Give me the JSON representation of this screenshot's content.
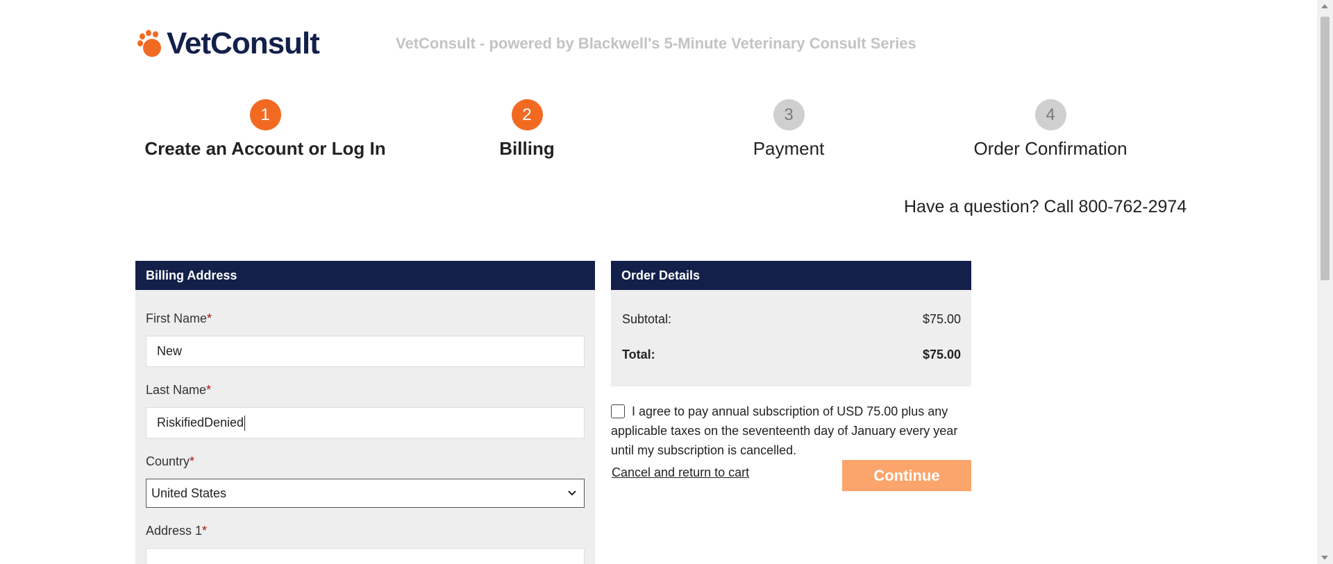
{
  "header": {
    "logo_text": "VetConsult",
    "tagline": "VetConsult - powered by Blackwell's 5-Minute Veterinary Consult Series"
  },
  "steps": [
    {
      "number": "1",
      "label": "Create an Account or Log In",
      "state": "completed"
    },
    {
      "number": "2",
      "label": "Billing",
      "state": "current"
    },
    {
      "number": "3",
      "label": "Payment",
      "state": "upcoming"
    },
    {
      "number": "4",
      "label": "Order Confirmation",
      "state": "upcoming"
    }
  ],
  "help": {
    "text": "Have a question? Call 800-762-2974"
  },
  "billing": {
    "title": "Billing Address",
    "first_name": {
      "label": "First Name",
      "required": "*",
      "value": "New"
    },
    "last_name": {
      "label": "Last Name",
      "required": "*",
      "value": "RiskifiedDenied"
    },
    "country": {
      "label": "Country",
      "required": "*",
      "value": "United States"
    },
    "address1": {
      "label": "Address 1",
      "required": "*",
      "value": ""
    }
  },
  "order": {
    "title": "Order Details",
    "subtotal_label": "Subtotal:",
    "subtotal_value": "$75.00",
    "total_label": "Total:",
    "total_value": "$75.00"
  },
  "agreement": {
    "text": "I agree to pay annual subscription of USD 75.00 plus any applicable taxes on the seventeenth day of January every year until my subscription is cancelled.",
    "checked": false
  },
  "actions": {
    "cancel_label": "Cancel and return to cart",
    "continue_label": "Continue"
  },
  "colors": {
    "brand_navy": "#13204a",
    "brand_orange": "#f26a22",
    "continue_disabled": "#fba56c",
    "panel_bg": "#eeeeee"
  }
}
